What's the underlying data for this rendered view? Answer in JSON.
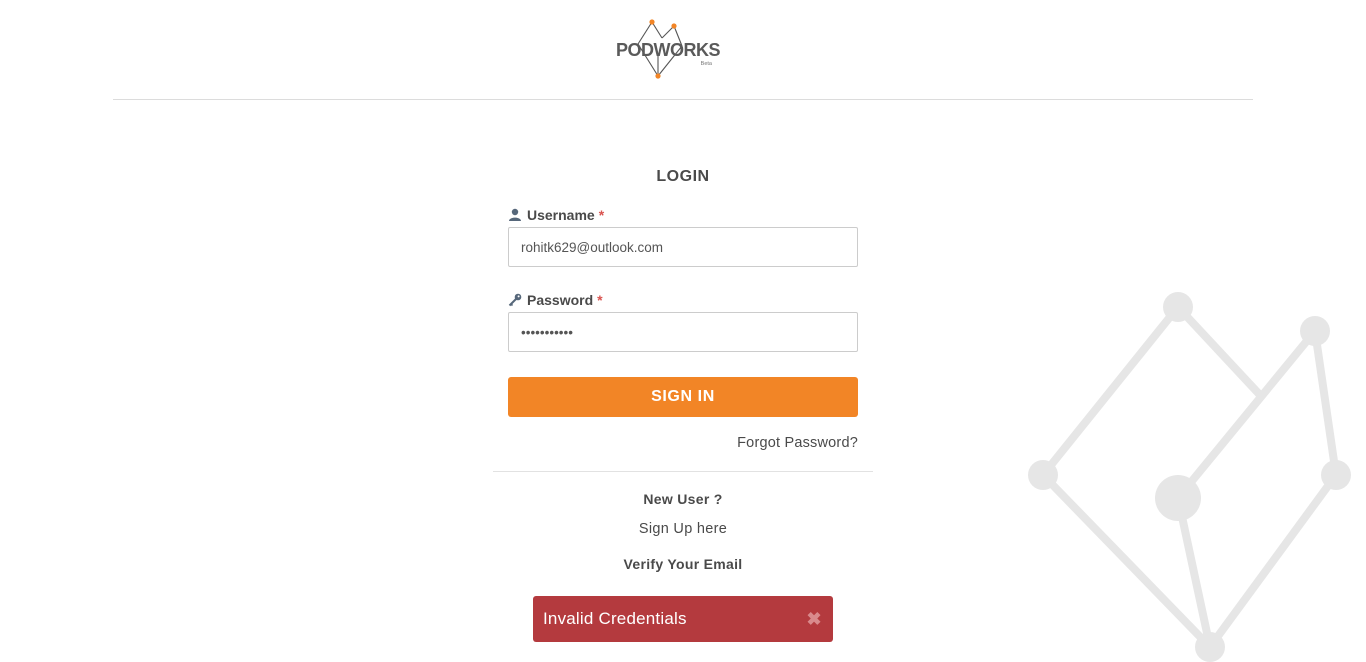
{
  "brand": {
    "logo_text": "PODWORKS",
    "logo_subtext": "Beta",
    "accent_color": "#f28526",
    "logo_dark_color": "#4a4a4a"
  },
  "login": {
    "title": "LOGIN",
    "username": {
      "icon": "user-icon",
      "label": "Username",
      "required_mark": "*",
      "value": "rohitk629@outlook.com"
    },
    "password": {
      "icon": "key-icon",
      "label": "Password",
      "required_mark": "*",
      "value": "•••••••••••"
    },
    "signin_label": "SIGN IN",
    "forgot_password": "Forgot Password?",
    "new_user": "New User ?",
    "signup": "Sign Up here",
    "verify_email": "Verify Your Email"
  },
  "alert": {
    "message": "Invalid Credentials",
    "close_icon": "close-icon",
    "color": "#b43a3e"
  }
}
